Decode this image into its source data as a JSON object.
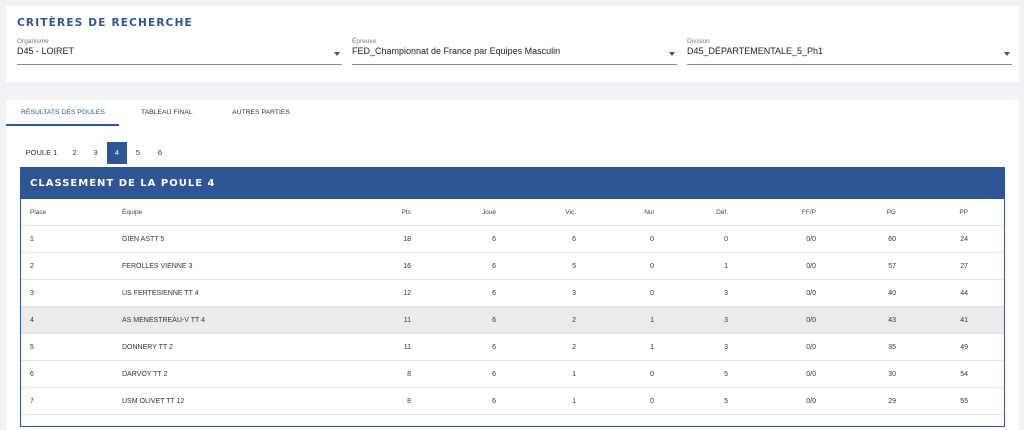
{
  "criteria": {
    "title": "CRITÈRES DE RECHERCHE",
    "organisme": {
      "label": "Organisme",
      "value": "D45 - LOIRET"
    },
    "epreuve": {
      "label": "Épreuve",
      "value": "FED_Championnat de France par Equipes Masculin"
    },
    "division": {
      "label": "Division",
      "value": "D45_DÉPARTEMENTALE_5_Ph1"
    }
  },
  "tabs": [
    "RÉSULTATS DES POULES",
    "TABLEAU FINAL",
    "AUTRES PARTIES"
  ],
  "pager": {
    "items": [
      "POULE 1",
      "2",
      "3",
      "4",
      "5",
      "6"
    ],
    "active": "4"
  },
  "table": {
    "title": "CLASSEMENT DE LA POULE 4",
    "headers": [
      "Place",
      "Équipe",
      "Pts",
      "Joué",
      "Vic.",
      "Nul",
      "Déf.",
      "FF/P",
      "PG",
      "PP"
    ],
    "rows": [
      [
        "1",
        "GIEN ASTT 5",
        "18",
        "6",
        "6",
        "0",
        "0",
        "0/0",
        "60",
        "24"
      ],
      [
        "2",
        "FEROLLES VIENNE 3",
        "16",
        "6",
        "5",
        "0",
        "1",
        "0/0",
        "57",
        "27"
      ],
      [
        "3",
        "US FERTESIENNE TT 4",
        "12",
        "6",
        "3",
        "0",
        "3",
        "0/0",
        "40",
        "44"
      ],
      [
        "4",
        "AS MENESTREAU-V TT 4",
        "11",
        "6",
        "2",
        "1",
        "3",
        "0/0",
        "43",
        "41"
      ],
      [
        "5",
        "DONNERY TT 2",
        "11",
        "6",
        "2",
        "1",
        "3",
        "0/0",
        "35",
        "49"
      ],
      [
        "6",
        "DARVOY TT 2",
        "8",
        "6",
        "1",
        "0",
        "5",
        "0/0",
        "30",
        "54"
      ],
      [
        "7",
        "USM OLIVET TT 12",
        "8",
        "6",
        "1",
        "0",
        "5",
        "0/0",
        "29",
        "55"
      ]
    ],
    "highlighted_row": "4"
  },
  "colors": {
    "accent": "#2f5596",
    "highlight": "#ebebeb",
    "background": "#f1f2f5"
  }
}
